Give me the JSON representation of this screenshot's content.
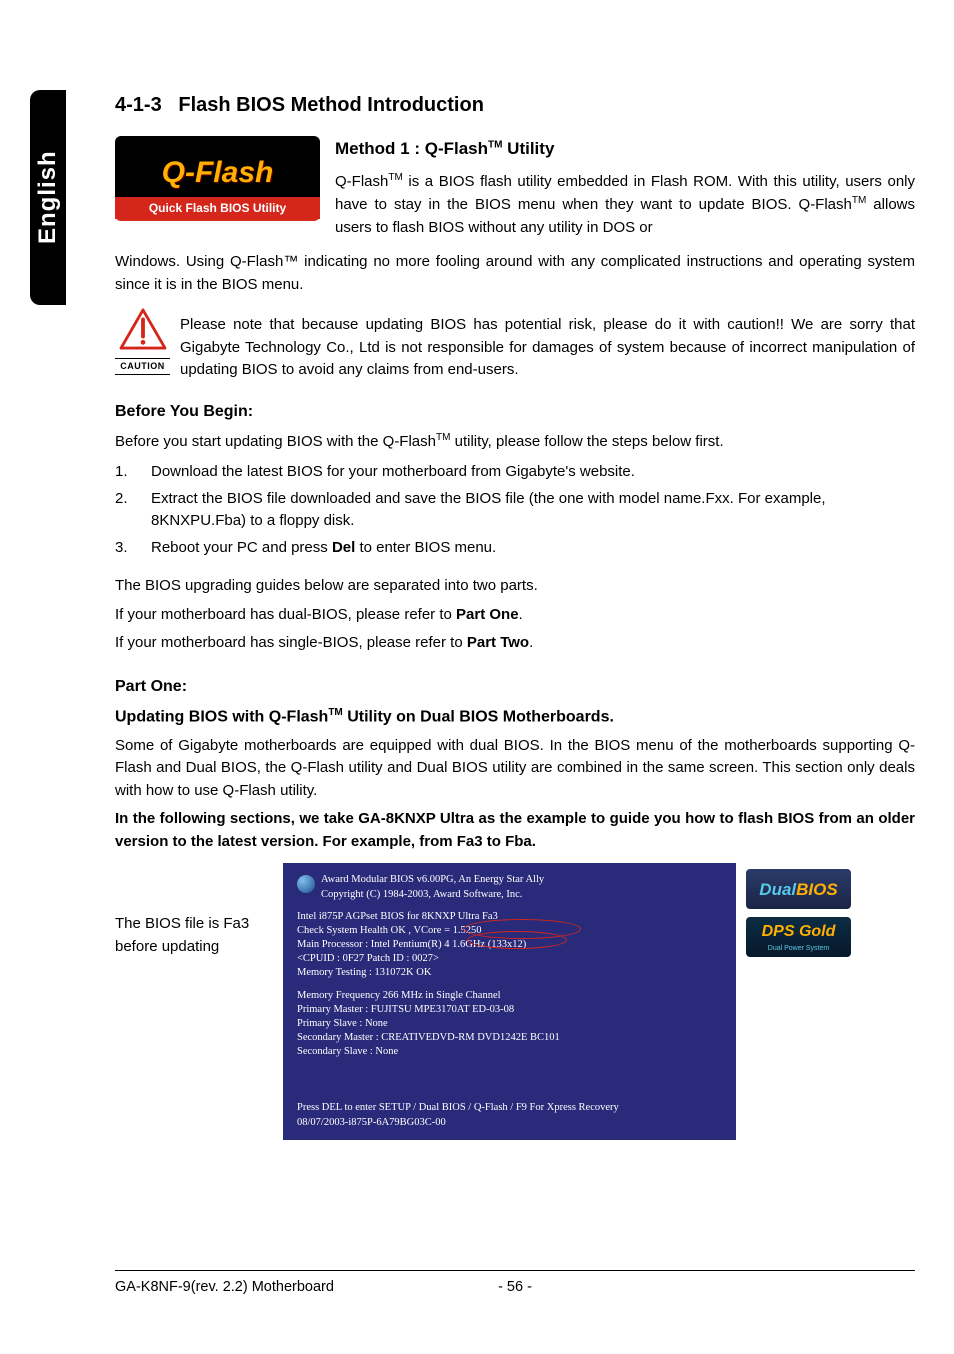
{
  "side_tab": "English",
  "section": {
    "number": "4-1-3",
    "title": "Flash BIOS Method Introduction"
  },
  "logo": {
    "top": "Q-Flash",
    "bottom": "Quick Flash BIOS Utility"
  },
  "method1": {
    "heading_prefix": "Method 1 : Q-Flash",
    "heading_suffix": " Utility",
    "para1_p1": "Q-Flash",
    "para1_p2": " is a BIOS flash utility embedded in Flash ROM. With this utility, users only have to stay in the BIOS menu when they want to update BIOS. Q-Flash",
    "para1_p3": " allows users to flash BIOS without any utility in DOS or",
    "para2": "Windows. Using Q-Flash™ indicating no more fooling around with any complicated instructions and operating system since it is in the BIOS menu."
  },
  "caution": {
    "label": "CAUTION",
    "text": "Please note that because updating BIOS has potential risk, please do it with caution!! We are sorry that Gigabyte Technology Co., Ltd is not responsible for damages of system because of incorrect manipulation of updating BIOS to avoid any claims from end-users."
  },
  "before": {
    "heading": "Before You Begin:",
    "intro_p1": "Before you start updating BIOS with the Q-Flash",
    "intro_p2": " utility, please follow the steps below first.",
    "steps": [
      "Download the latest BIOS for your motherboard from Gigabyte's website.",
      "Extract the BIOS file downloaded and save the BIOS file (the one with model name.Fxx. For example, 8KNXPU.Fba) to a floppy disk.",
      "Reboot your PC and press Del to enter BIOS menu."
    ],
    "note_l1": "The BIOS upgrading guides below are separated into two parts.",
    "note_l2a": "If your motherboard has dual-BIOS, please refer to ",
    "note_l2b": "Part One",
    "note_l3a": "If your motherboard has single-BIOS, please refer to ",
    "note_l3b": "Part Two"
  },
  "part_one": {
    "heading": "Part One:",
    "sub_prefix": "Updating BIOS with Q-Flash",
    "sub_suffix": " Utility on Dual BIOS Motherboards.",
    "para": "Some of Gigabyte motherboards are equipped with dual BIOS. In the BIOS menu of the motherboards supporting Q-Flash and Dual BIOS, the Q-Flash utility and Dual BIOS utility are combined in the same screen. This section only deals with how to use Q-Flash utility.",
    "bold": "In the following sections, we take GA-8KNXP Ultra as the example to guide you how to flash BIOS from an older version to the latest version. For example, from Fa3 to Fba."
  },
  "bios_caption": "The BIOS file is Fa3 before updating",
  "bios_screen": {
    "l1": "Award Modular BIOS v6.00PG, An Energy Star Ally",
    "l2": "Copyright  (C) 1984-2003, Award Software,   Inc.",
    "l3": "Intel i875P AGPset BIOS for 8KNXP Ultra Fa3",
    "l4": "Check System Health OK , VCore = 1.5250",
    "l5": "Main Processor :  Intel Pentium(R) 4   1.6GHz (133x12)",
    "l6": "<CPUID : 0F27 Patch ID  : 0027>",
    "l7": "Memory Testing   : 131072K OK",
    "l8": "Memory Frequency 266 MHz in Single Channel",
    "l9": "Primary Master : FUJITSU MPE3170AT ED-03-08",
    "l10": "Primary Slave : None",
    "l11": "Secondary Master :  CREATIVEDVD-RM DVD1242E BC101",
    "l12": "Secondary Slave : None",
    "l13": "Press DEL to enter SETUP / Dual BIOS / Q-Flash / F9 For Xpress Recovery",
    "l14": "08/07/2003-i875P-6A79BG03C-00"
  },
  "badges": {
    "dual_a": "Dual",
    "dual_b": "BIOS",
    "dps_a": "DPS Gold",
    "dps_b": "Dual Power System"
  },
  "footer": {
    "left": "GA-K8NF-9(rev. 2.2) Motherboard",
    "center": "- 56 -"
  }
}
